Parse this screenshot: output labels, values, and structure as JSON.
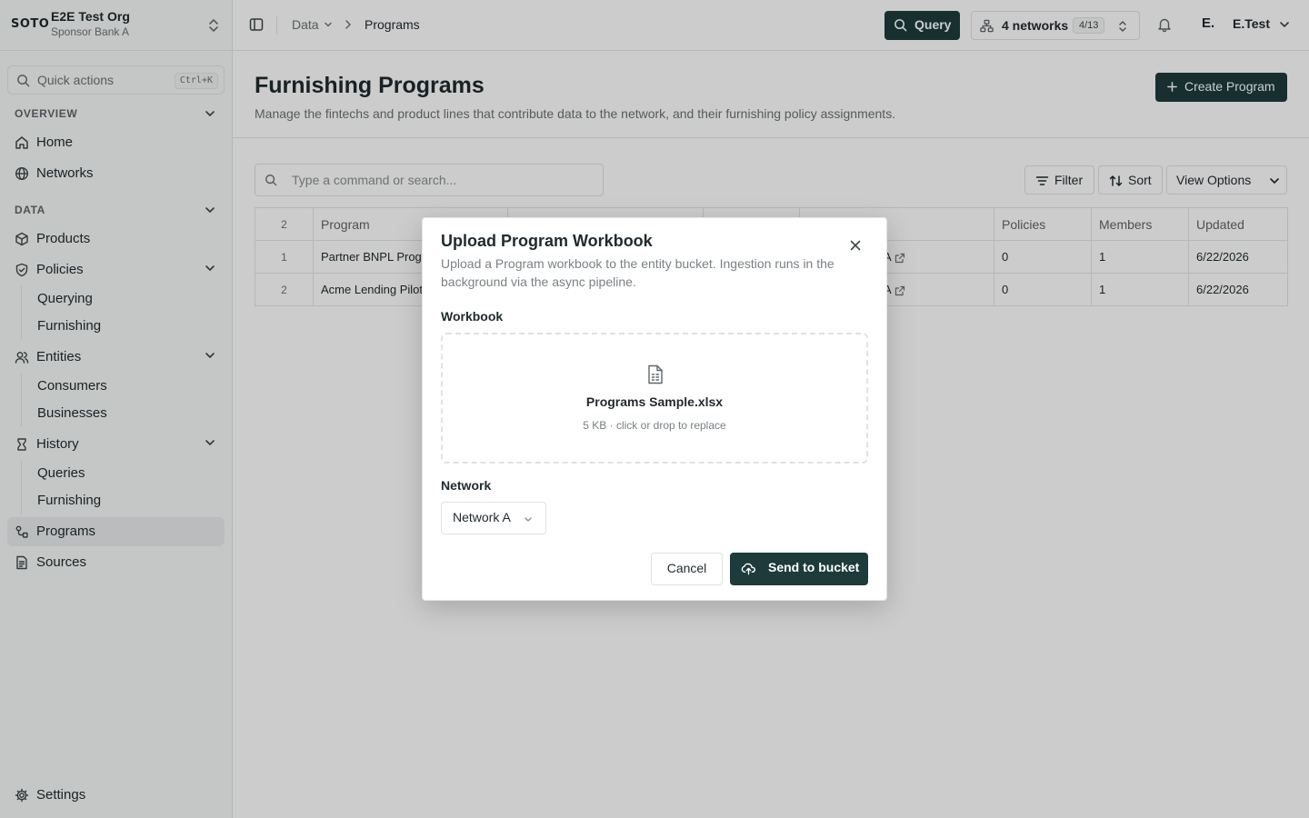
{
  "org": {
    "logo": "SOTO",
    "name": "E2E Test Org",
    "sub": "Sponsor Bank A"
  },
  "quick_actions": {
    "label": "Quick actions",
    "shortcut": "Ctrl+K"
  },
  "sidebar": {
    "overview_label": "OVERVIEW",
    "data_label": "DATA",
    "home": "Home",
    "networks": "Networks",
    "products": "Products",
    "policies": "Policies",
    "policies_sub": [
      "Querying",
      "Furnishing"
    ],
    "entities": "Entities",
    "entities_sub": [
      "Consumers",
      "Businesses"
    ],
    "history": "History",
    "history_sub": [
      "Queries",
      "Furnishing"
    ],
    "programs": "Programs",
    "sources": "Sources",
    "settings": "Settings"
  },
  "topbar": {
    "breadcrumb": [
      "Data",
      "Programs"
    ],
    "query_label": "Query",
    "networks_label": "4 networks",
    "networks_badge": "4/13",
    "avatar": "E.",
    "user_name": "E.Test"
  },
  "page": {
    "title": "Furnishing Programs",
    "description": "Manage the fintechs and product lines that contribute data to the network, and their furnishing policy assignments.",
    "create_label": "Create Program"
  },
  "toolbar": {
    "search_placeholder": "Type a command or search...",
    "filter_label": "Filter",
    "sort_label": "Sort",
    "view_options_label": "View Options"
  },
  "table": {
    "count": "2",
    "columns": [
      "Program",
      "",
      "",
      "",
      "Policies",
      "Members",
      "Updated"
    ],
    "rows": [
      {
        "num": "1",
        "program": "Partner BNPL Program",
        "network": "A",
        "policies": "0",
        "members": "1",
        "updated": "6/22/2026"
      },
      {
        "num": "2",
        "program": "Acme Lending Pilot",
        "network": "A",
        "policies": "0",
        "members": "1",
        "updated": "6/22/2026"
      }
    ]
  },
  "modal": {
    "title": "Upload Program Workbook",
    "description": "Upload a Program workbook to the entity bucket. Ingestion runs in the background via the async pipeline.",
    "workbook_label": "Workbook",
    "file_name": "Programs Sample.xlsx",
    "file_meta": "5 KB · click or drop to replace",
    "network_label": "Network",
    "network_value": "Network A",
    "cancel_label": "Cancel",
    "send_label": "Send to bucket"
  },
  "colors": {
    "accent": "#1d3b3b",
    "sidebar_bg": "#f7f8f8",
    "border": "#e3e5e6"
  }
}
